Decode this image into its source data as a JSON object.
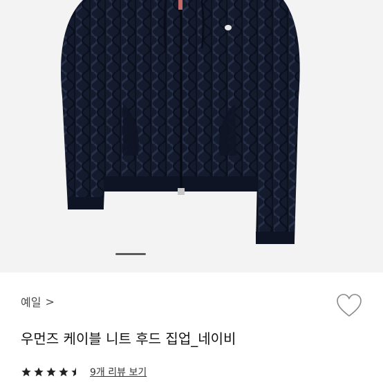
{
  "product": {
    "brand": "예일",
    "brand_chevron": ">",
    "title": "우먼즈 케이블 니트 후드 집업_네이비",
    "rating": 4.5,
    "rating_max": 5,
    "review_link": "9개 리뷰 보기",
    "image_icon": "navy-cable-knit-hoodie-photo",
    "colors": {
      "garment": "#141b2c",
      "background": "#f3f3f3",
      "star": "#222222"
    }
  },
  "carousel": {
    "indicator_icon": "carousel-progress-bar"
  },
  "wishlist": {
    "icon": "heart-outline-icon"
  }
}
